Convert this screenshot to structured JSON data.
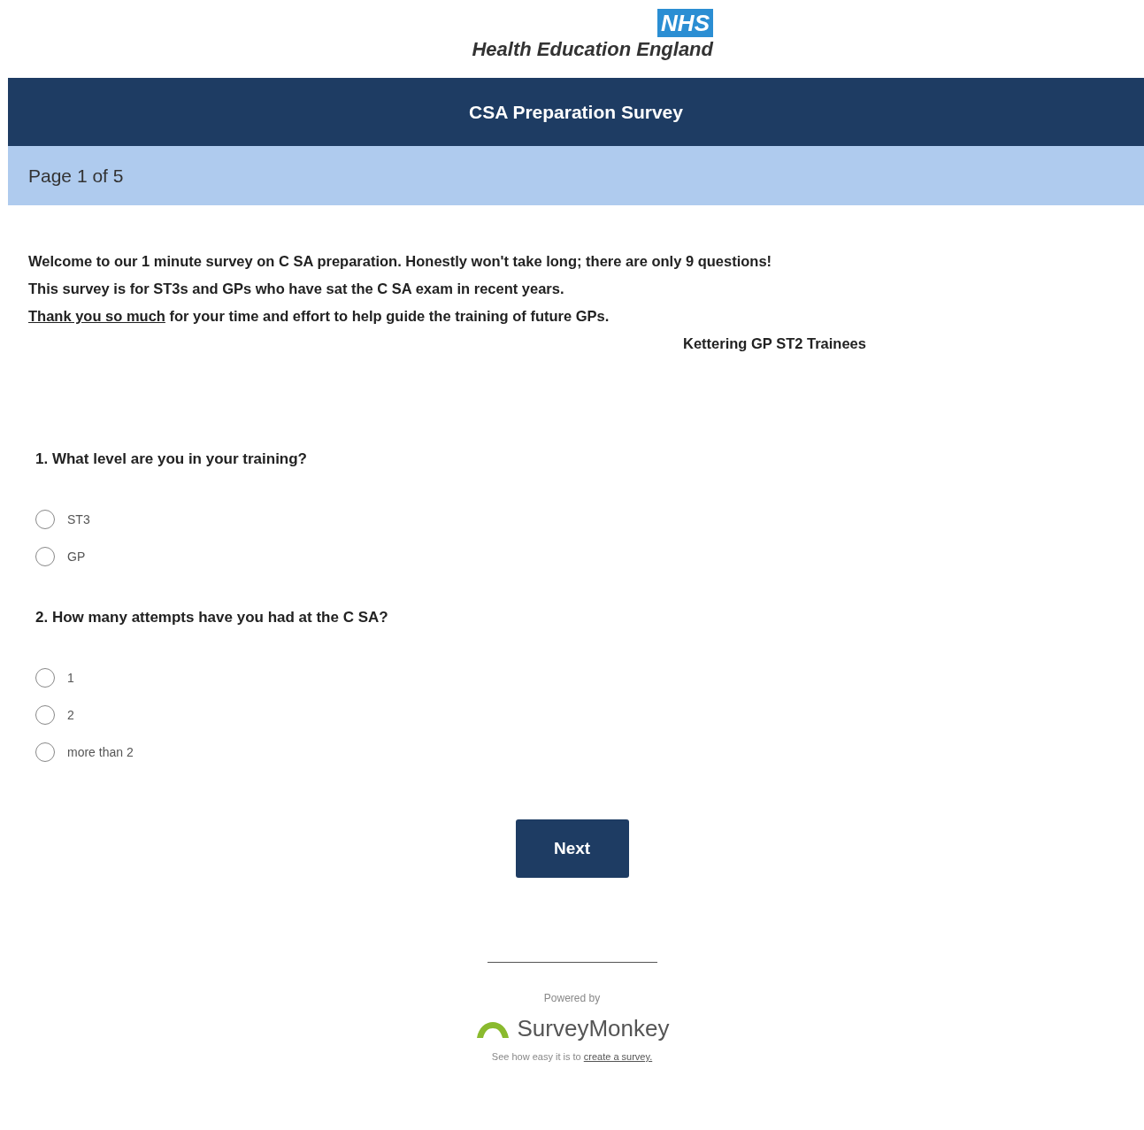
{
  "logo": {
    "badge": "NHS",
    "name": "Health Education England"
  },
  "header": {
    "title": "CSA Preparation Survey"
  },
  "page_indicator": "Page 1 of 5",
  "intro": {
    "lines": [
      "Welcome to our 1 minute survey on C SA preparation. Honestly won't take long; there are only 9 questions!",
      "This survey is for ST3s and GPs who have sat the C SA exam in recent years."
    ],
    "thanks_underlined": "Thank you so much",
    "thanks_rest": " for your time and effort to help guide the training of future GPs.",
    "signature": "Kettering GP ST2 Trainees"
  },
  "questions": [
    {
      "title": "1. What level are you in your training?",
      "options": [
        {
          "label": "ST3",
          "selected": false
        },
        {
          "label": "GP",
          "selected": false
        }
      ]
    },
    {
      "title": "2. How many attempts have you had at the C SA?",
      "options": [
        {
          "label": "1",
          "selected": false
        },
        {
          "label": "2",
          "selected": false
        },
        {
          "label": "more than 2",
          "selected": false
        }
      ]
    }
  ],
  "next_button": "Next",
  "footer": {
    "powered_by": "Powered by",
    "brand": "SurveyMonkey",
    "tagline": "See how easy it is to ",
    "link": "create a survey."
  }
}
